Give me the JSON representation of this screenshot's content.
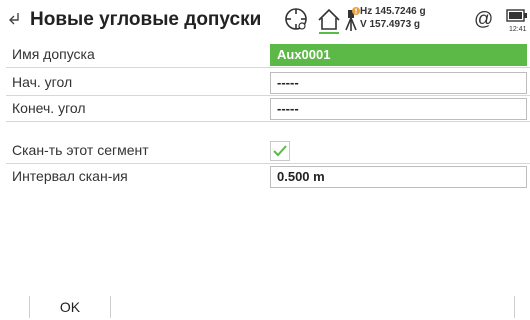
{
  "header": {
    "title": "Новые угловые допуски",
    "hz": "Hz 145.7246 g",
    "v": "V  157.4973 g",
    "time": "12:41",
    "icons": [
      "back-icon",
      "target-icon",
      "home-icon",
      "tripod-icon",
      "at-icon",
      "battery-icon"
    ]
  },
  "form": {
    "rows": [
      {
        "label": "Имя допуска",
        "value": "Aux0001"
      },
      {
        "label": "Нач. угол",
        "value": "-----"
      },
      {
        "label": "Конеч. угол",
        "value": "-----"
      },
      {
        "label": "Скан-ть этот сегмент",
        "checked": true
      },
      {
        "label": "Интервал скан-ия",
        "value": "0.500 m"
      }
    ]
  },
  "footer": {
    "ok_label": "OK"
  },
  "colors": {
    "accent_green": "#5cb847",
    "badge_orange": "#e8a33d"
  }
}
